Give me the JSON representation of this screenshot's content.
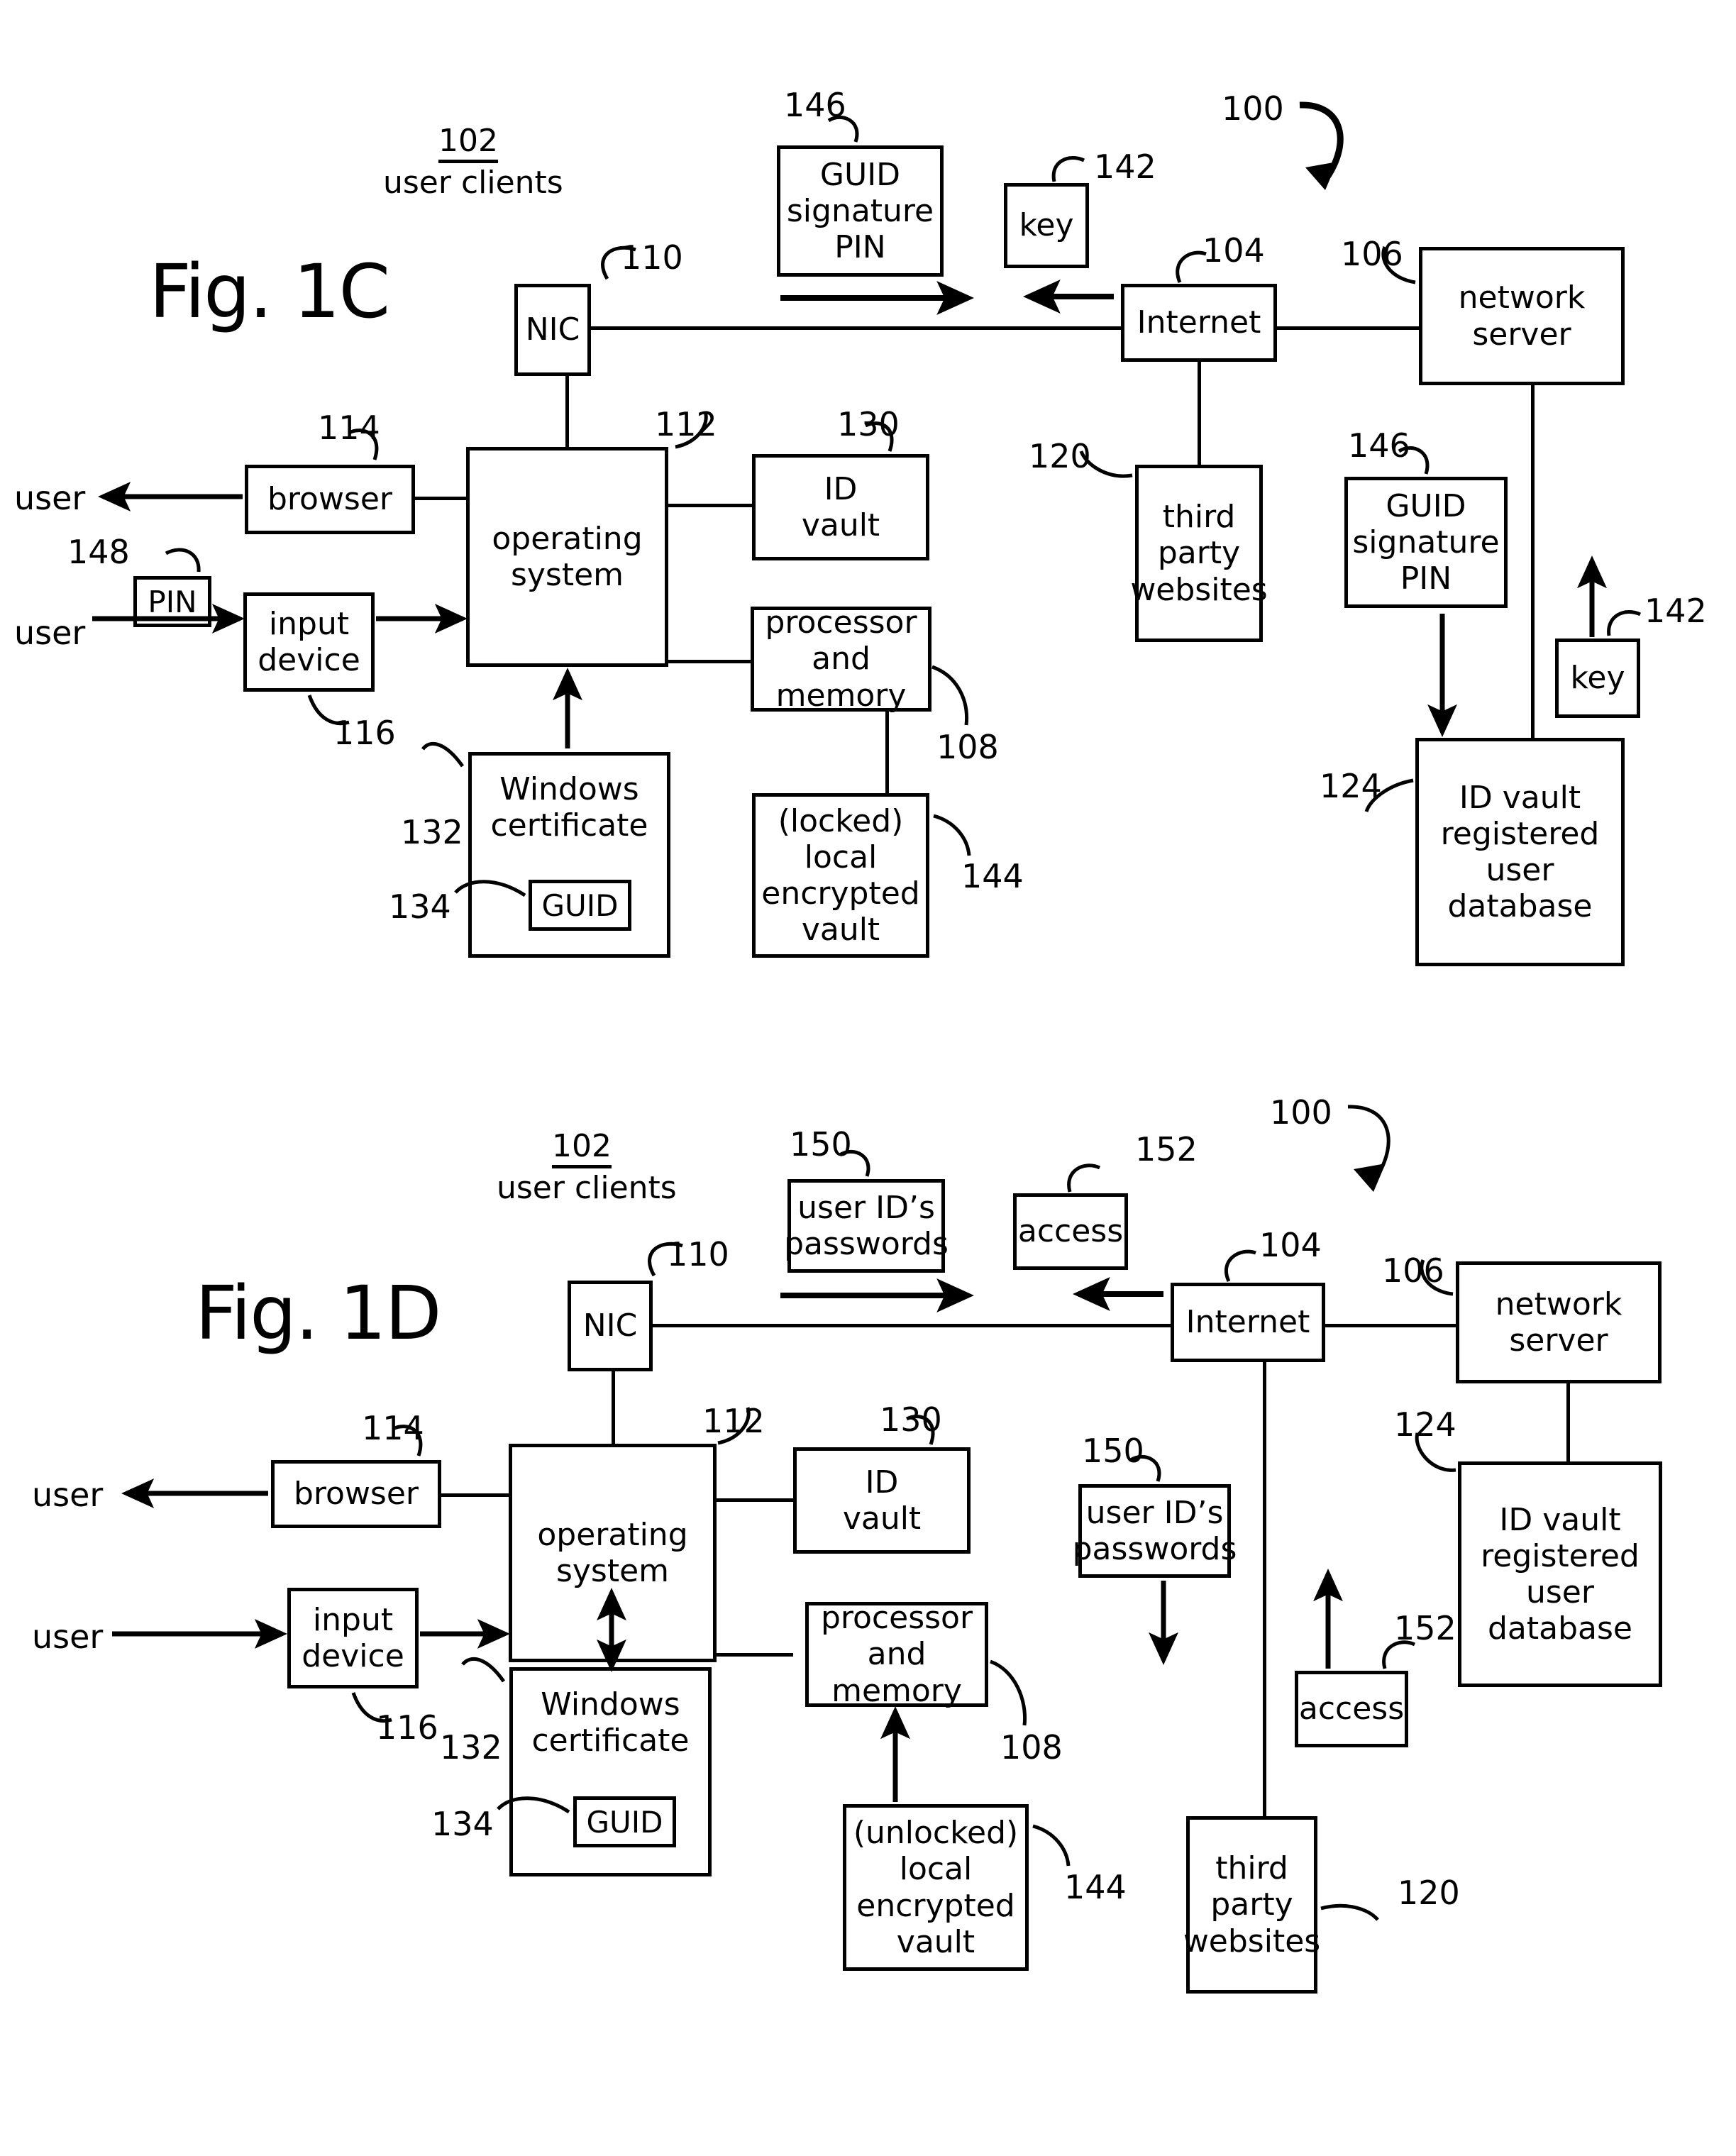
{
  "figures": [
    {
      "id": "fig1c",
      "title": "Fig. 1C",
      "system_ref": "100",
      "group": {
        "num": "102",
        "caption": "user clients"
      },
      "nodes": {
        "nic": "NIC",
        "browser": "browser",
        "input_device": "input\ndevice",
        "operating_system": "operating\nsystem",
        "id_vault": "ID\nvault",
        "processor": "processor\nand memory",
        "windows_certificate": "Windows\ncertificate",
        "guid": "GUID",
        "local_vault": "(locked)\nlocal\nencrypted\nvault",
        "pin": "PIN",
        "guid_signature_pin_out": "GUID\nsignature\nPIN",
        "key_out": "key",
        "internet": "Internet",
        "network_server": "network\nserver",
        "third_party": "third\nparty\nwebsites",
        "guid_signature_pin_srv": "GUID\nsignature\nPIN",
        "key_srv": "key",
        "registered_db": "ID vault\nregistered\nuser\ndatabase"
      },
      "refs": {
        "nic": "110",
        "browser": "114",
        "input_device": "116",
        "operating_system": "112",
        "id_vault": "130",
        "processor": "108",
        "windows_certificate": "132",
        "guid": "134",
        "local_vault": "144",
        "pin": "148",
        "guid_signature_pin_out": "146",
        "key_out": "142",
        "internet": "104",
        "network_server": "106",
        "third_party": "120",
        "guid_signature_pin_srv": "146",
        "key_srv": "142",
        "registered_db": "124"
      },
      "actors": {
        "user_out": "user",
        "user_in": "user"
      }
    },
    {
      "id": "fig1d",
      "title": "Fig. 1D",
      "system_ref": "100",
      "group": {
        "num": "102",
        "caption": "user clients"
      },
      "nodes": {
        "nic": "NIC",
        "browser": "browser",
        "input_device": "input\ndevice",
        "operating_system": "operating\nsystem",
        "id_vault": "ID\nvault",
        "processor": "processor\nand memory",
        "windows_certificate": "Windows\ncertificate",
        "guid": "GUID",
        "local_vault": "(unlocked)\nlocal\nencrypted\nvault",
        "user_ids_out": "user ID’s\npasswords",
        "access_out": "access",
        "internet": "Internet",
        "network_server": "network\nserver",
        "registered_db": "ID vault\nregistered\nuser\ndatabase",
        "user_ids_srv": "user ID’s\npasswords",
        "access_srv": "access",
        "third_party": "third\nparty\nwebsites"
      },
      "refs": {
        "nic": "110",
        "browser": "114",
        "input_device": "116",
        "operating_system": "112",
        "id_vault": "130",
        "processor": "108",
        "windows_certificate": "132",
        "guid": "134",
        "local_vault": "144",
        "user_ids_out": "150",
        "access_out": "152",
        "internet": "104",
        "network_server": "106",
        "registered_db": "124",
        "user_ids_srv": "150",
        "access_srv": "152",
        "third_party": "120"
      },
      "actors": {
        "user_out": "user",
        "user_in": "user"
      }
    }
  ]
}
